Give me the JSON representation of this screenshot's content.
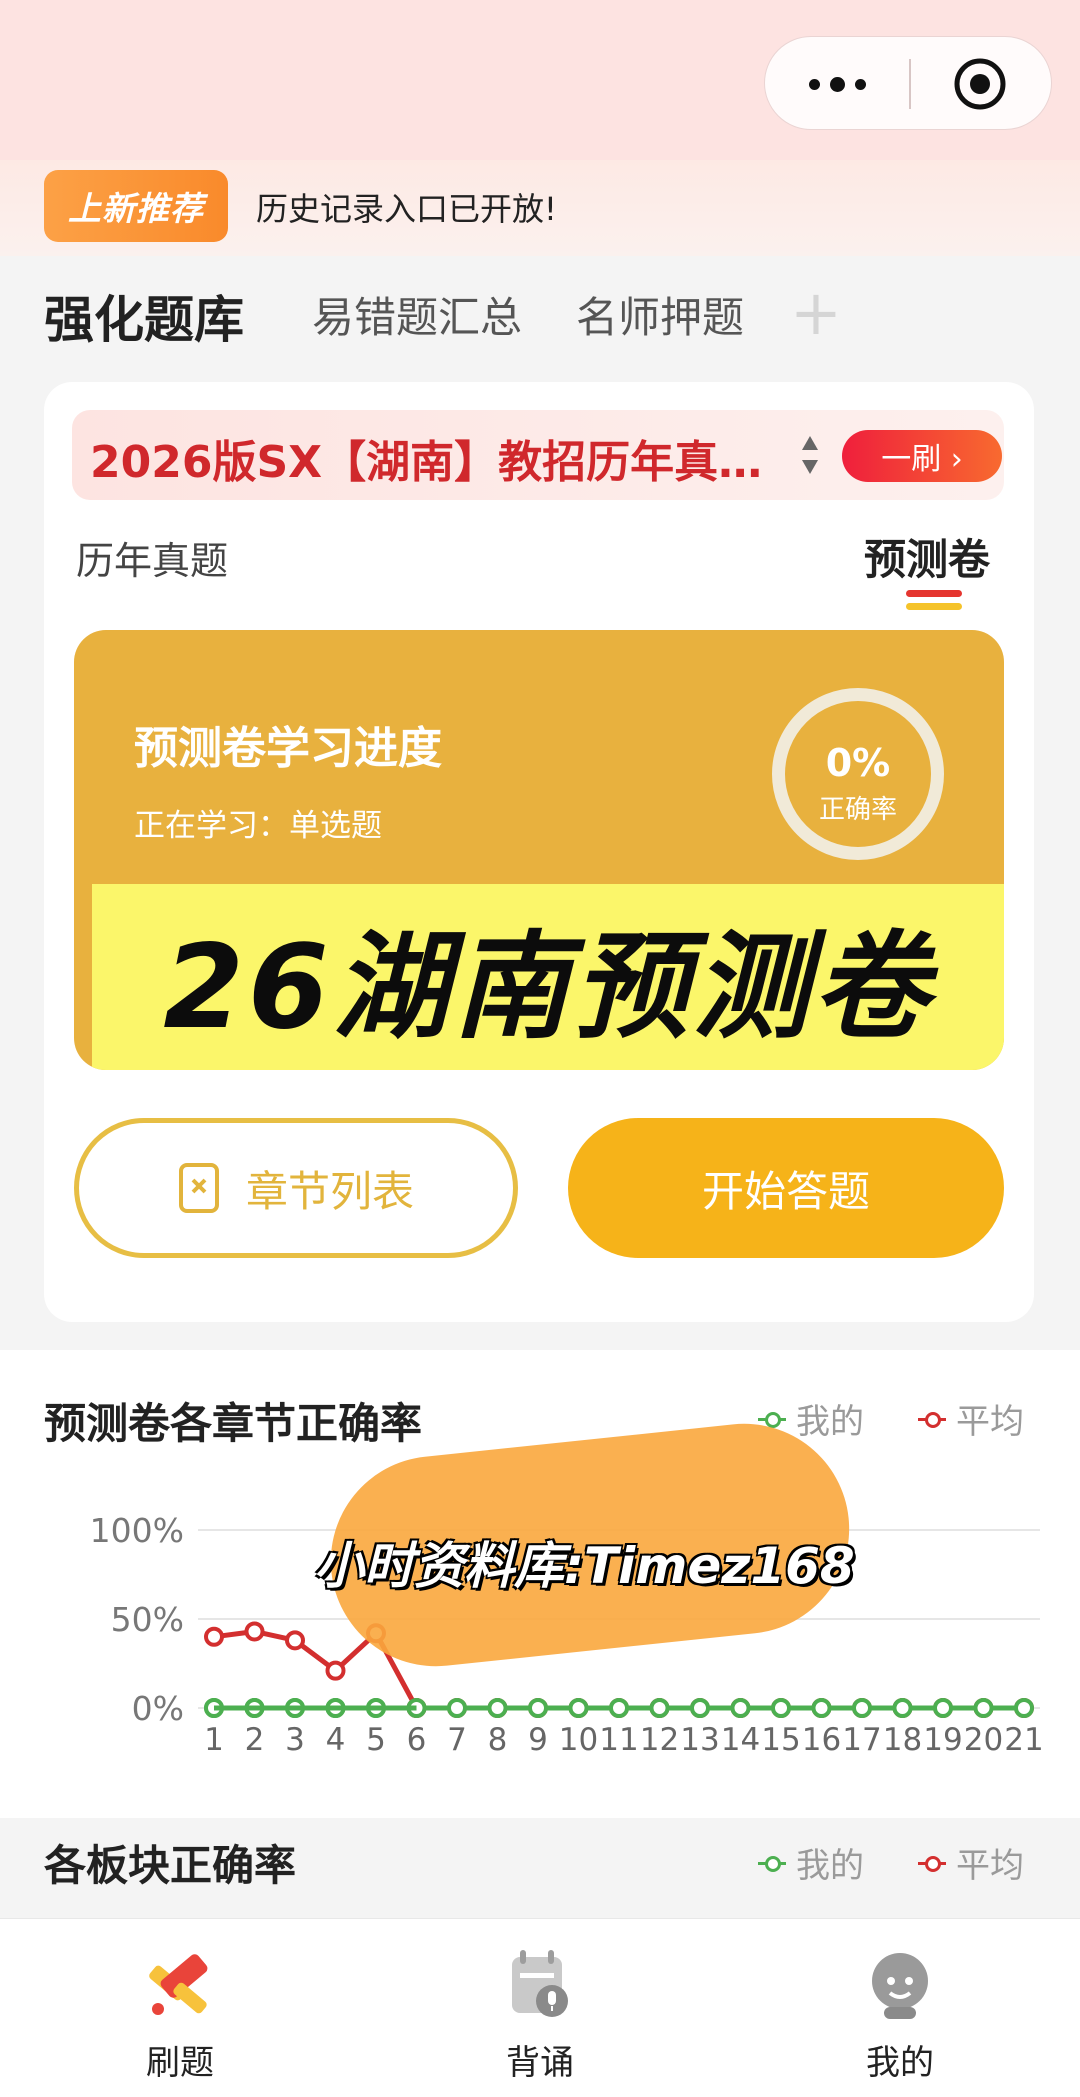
{
  "header": {
    "more_icon": "more-dots-icon",
    "close_icon": "target-close-icon"
  },
  "announcement": {
    "badge": "上新推荐",
    "text": "历史记录入口已开放!"
  },
  "tabs": [
    {
      "label": "强化题库",
      "active": true
    },
    {
      "label": "易错题汇总"
    },
    {
      "label": "名师押题"
    },
    {
      "label": "+"
    }
  ],
  "card": {
    "bank_title": "2026版SX【湖南】教招历年真…",
    "round_button": "一刷 ›",
    "sub_tabs": {
      "history": "历年真题",
      "predict": "预测卷"
    },
    "progress": {
      "title": "预测卷学习进度",
      "studying": "正在学习：单选题",
      "accuracy_value": "0%",
      "accuracy_label": "正确率"
    },
    "promo": "26湖南预测卷",
    "chapter_button": "章节列表",
    "start_button": "开始答题"
  },
  "chart_section": {
    "title": "预测卷各章节正确率",
    "legend_mine": "我的",
    "legend_avg": "平均",
    "watermark": "小时资料库:Timez168"
  },
  "chart_data": {
    "type": "line",
    "x": [
      "1",
      "2",
      "3",
      "4",
      "5",
      "6",
      "7",
      "8",
      "9",
      "10",
      "11",
      "12",
      "13",
      "14",
      "15",
      "16",
      "17",
      "18",
      "19",
      "20",
      "21"
    ],
    "series": [
      {
        "name": "我的",
        "color": "#4caf50",
        "values": [
          0,
          0,
          0,
          0,
          0,
          0,
          0,
          0,
          0,
          0,
          0,
          0,
          0,
          0,
          0,
          0,
          0,
          0,
          0,
          0,
          0
        ]
      },
      {
        "name": "平均",
        "color": "#d32f2f",
        "values": [
          40,
          43,
          38,
          21,
          42,
          0,
          0,
          0,
          0,
          0,
          0,
          0,
          0,
          0,
          0,
          0,
          0,
          0,
          0,
          0,
          0
        ]
      }
    ],
    "y_ticks": [
      "100%",
      "50%",
      "0%"
    ],
    "ylim": [
      0,
      100
    ],
    "grid": true,
    "legend": "top-right"
  },
  "blocks_section": {
    "title": "各板块正确率",
    "legend_mine": "我的",
    "legend_avg": "平均"
  },
  "bottom_nav": [
    {
      "label": "刷题",
      "icon": "pencil-icon",
      "active": true
    },
    {
      "label": "背诵",
      "icon": "calendar-mic-icon"
    },
    {
      "label": "我的",
      "icon": "user-avatar-icon"
    }
  ]
}
